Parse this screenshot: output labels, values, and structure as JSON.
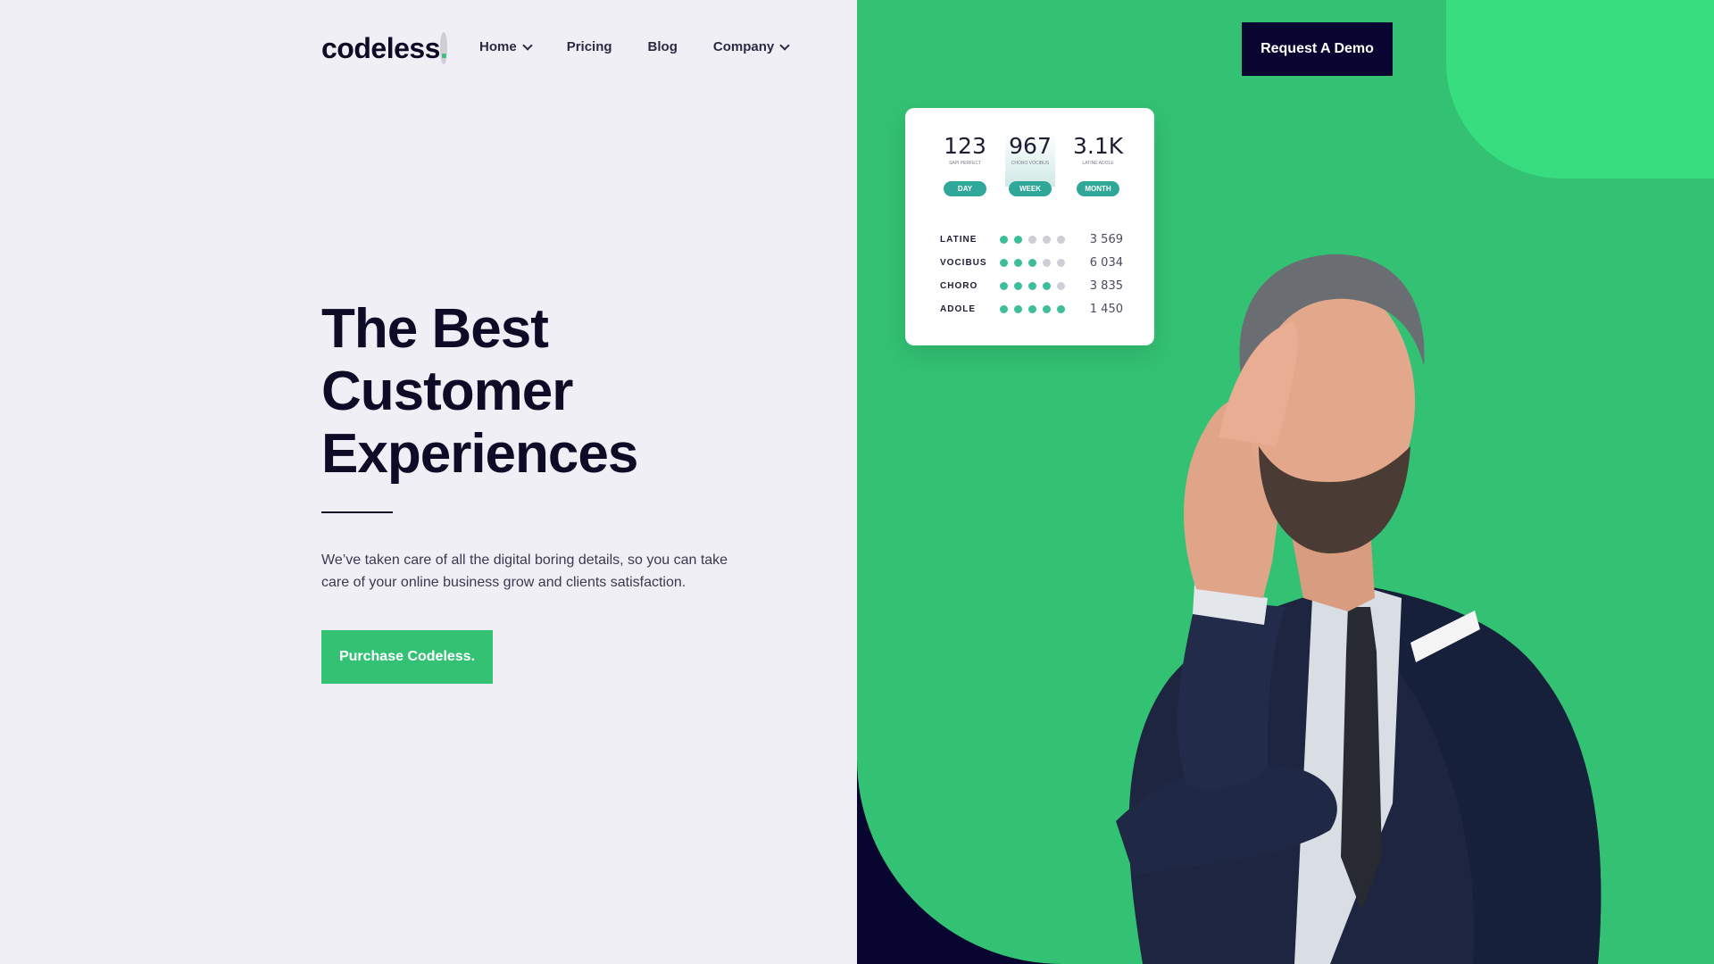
{
  "brand": {
    "name": "codeless",
    "dot": "."
  },
  "nav": {
    "items": [
      {
        "label": "Home",
        "has_dropdown": true
      },
      {
        "label": "Pricing",
        "has_dropdown": false
      },
      {
        "label": "Blog",
        "has_dropdown": false
      },
      {
        "label": "Company",
        "has_dropdown": true
      }
    ]
  },
  "header": {
    "cta_label": "Request A Demo"
  },
  "hero": {
    "title_lines": [
      "The Best",
      "Customer",
      "Experiences"
    ],
    "description": "We’ve taken care of all the digital boring details, so you can take care of your online business grow and clients satisfaction.",
    "cta_label": "Purchase Codeless."
  },
  "stats_card": {
    "columns": [
      {
        "value": "123",
        "sub": "SAPI PERFECT",
        "pill": "DAY",
        "active": false
      },
      {
        "value": "967",
        "sub": "CHORO VOCIBUS",
        "pill": "WEEK",
        "active": true
      },
      {
        "value": "3.1K",
        "sub": "LATINE ADOLE",
        "pill": "MONTH",
        "active": false
      }
    ],
    "rows": [
      {
        "label": "LATINE",
        "rating": 2,
        "max": 5,
        "value": "3 569"
      },
      {
        "label": "VOCIBUS",
        "rating": 3,
        "max": 5,
        "value": "6 034"
      },
      {
        "label": "CHORO",
        "rating": 4,
        "max": 5,
        "value": "3 835"
      },
      {
        "label": "ADOLE",
        "rating": 5,
        "max": 5,
        "value": "1 450"
      }
    ]
  },
  "colors": {
    "accent_green": "#33c274",
    "light_green": "#38dd80",
    "navy": "#080530",
    "background": "#f0eff6",
    "teal": "#2fa89a"
  },
  "icons": [
    "chevron-down-icon"
  ]
}
